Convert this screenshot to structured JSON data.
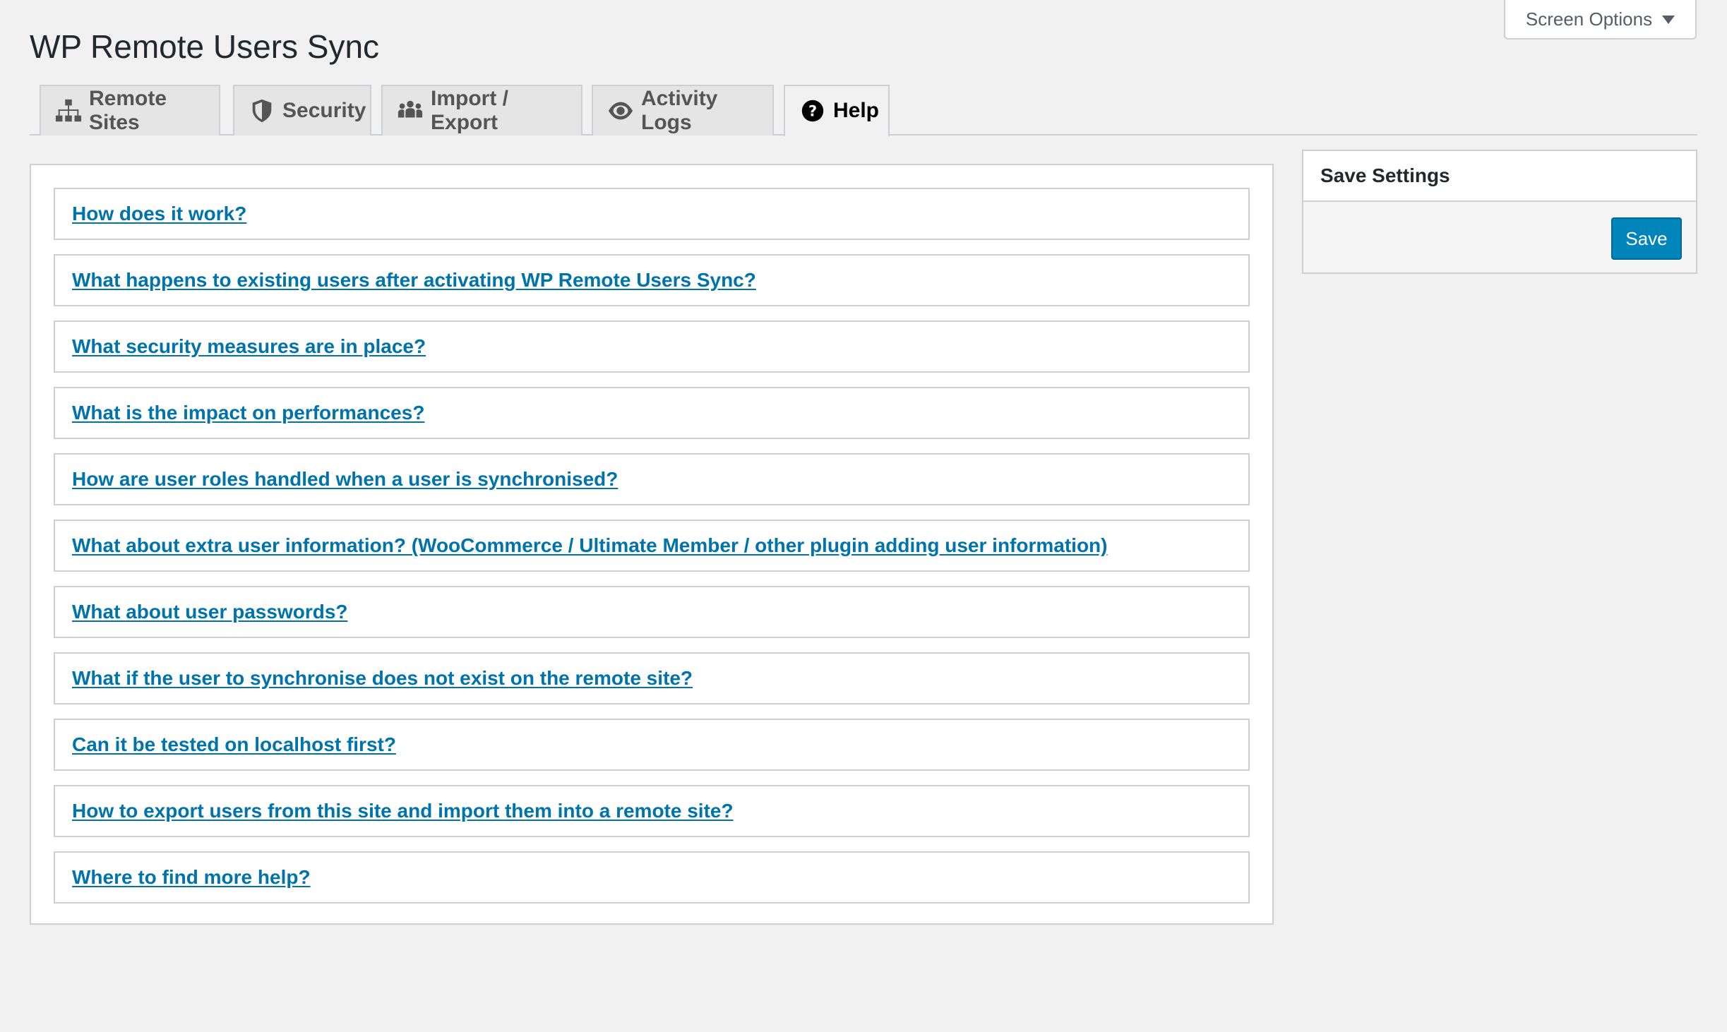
{
  "screen_options": {
    "label": "Screen Options",
    "icon": "caret-down-icon"
  },
  "page": {
    "title": "WP Remote Users Sync"
  },
  "tabs": [
    {
      "label": "Remote Sites",
      "icon": "sitemap-icon",
      "active": false
    },
    {
      "label": "Security",
      "icon": "shield-icon",
      "active": false
    },
    {
      "label": "Import / Export",
      "icon": "users-group-icon",
      "active": false
    },
    {
      "label": "Activity Logs",
      "icon": "eye-icon",
      "active": false
    },
    {
      "label": "Help",
      "icon": "question-circle-icon",
      "active": true
    }
  ],
  "faq": [
    "How does it work?",
    "What happens to existing users after activating WP Remote Users Sync?",
    "What security measures are in place?",
    "What is the impact on performances?",
    "How are user roles handled when a user is synchronised?",
    "What about extra user information? (WooCommerce / Ultimate Member / other plugin adding user information)",
    "What about user passwords?",
    "What if the user to synchronise does not exist on the remote site?",
    "Can it be tested on localhost first?",
    "How to export users from this site and import them into a remote site?",
    "Where to find more help?"
  ],
  "sidebar": {
    "title": "Save Settings",
    "save_label": "Save"
  },
  "colors": {
    "link": "#0073aa",
    "primary_button": "#0085ba",
    "background": "#f1f1f1",
    "border": "#ccd0d4"
  }
}
